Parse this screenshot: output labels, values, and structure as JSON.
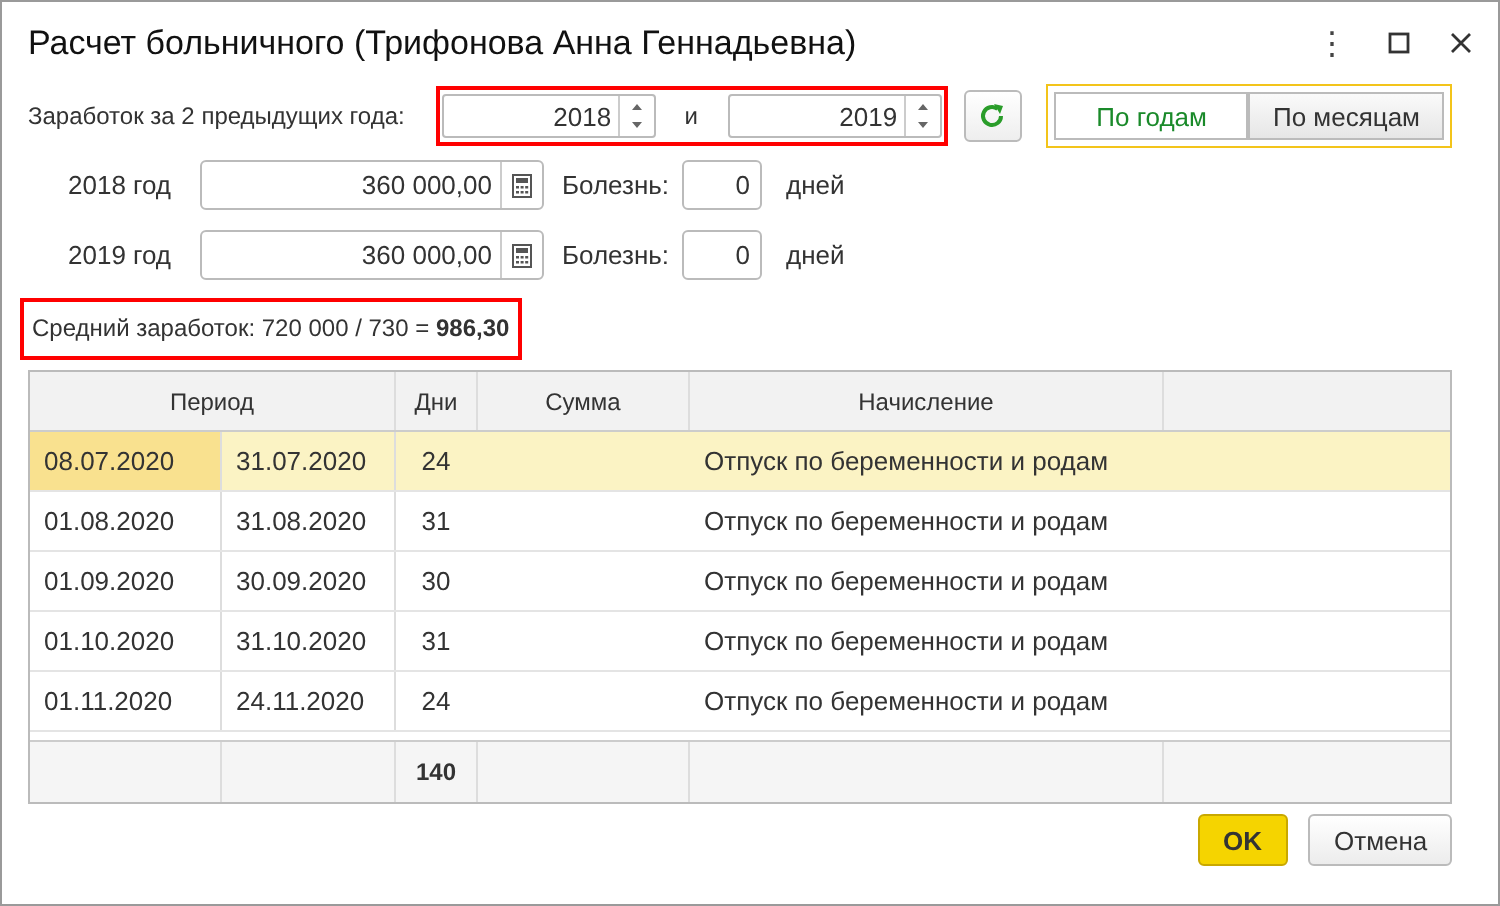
{
  "window": {
    "title": "Расчет больничного (Трифонова Анна Геннадьевна)",
    "menu_icon": "⋮"
  },
  "year_range": {
    "label": "Заработок за 2 предыдущих года:",
    "highlighted": true,
    "from": "2018",
    "separator": "и",
    "to": "2019"
  },
  "mode_toggle": {
    "highlighted": true,
    "options": [
      {
        "label": "По годам",
        "selected": true
      },
      {
        "label": "По месяцам",
        "selected": false
      }
    ]
  },
  "years": [
    {
      "label": "2018 год",
      "earnings": "360 000,00",
      "illness_label": "Болезнь:",
      "illness_days": "0",
      "days_unit": "дней"
    },
    {
      "label": "2019 год",
      "earnings": "360 000,00",
      "illness_label": "Болезнь:",
      "illness_days": "0",
      "days_unit": "дней"
    }
  ],
  "average": {
    "text": "Средний заработок: 720 000 / 730 = **986,30**",
    "highlighted": true
  },
  "table": {
    "columns": [
      "Период",
      "Дни",
      "Сумма",
      "Начисление"
    ],
    "rows": [
      {
        "start": "08.07.2020",
        "end": "31.07.2020",
        "days": "24",
        "accrual": "Отпуск по беременности и родам",
        "selected": true
      },
      {
        "start": "01.08.2020",
        "end": "31.08.2020",
        "days": "31",
        "accrual": "Отпуск по беременности и родам",
        "selected": false
      },
      {
        "start": "01.09.2020",
        "end": "30.09.2020",
        "days": "30",
        "accrual": "Отпуск по беременности и родам",
        "selected": false
      },
      {
        "start": "01.10.2020",
        "end": "31.10.2020",
        "days": "31",
        "accrual": "Отпуск по беременности и родам",
        "selected": false
      },
      {
        "start": "01.11.2020",
        "end": "24.11.2020",
        "days": "24",
        "accrual": "Отпуск по беременности и родам",
        "selected": false
      }
    ],
    "total_days": "140"
  },
  "buttons": [
    {
      "label": "OK",
      "kind": "primary"
    },
    {
      "label": "Отмена",
      "kind": "secondary"
    }
  ]
}
